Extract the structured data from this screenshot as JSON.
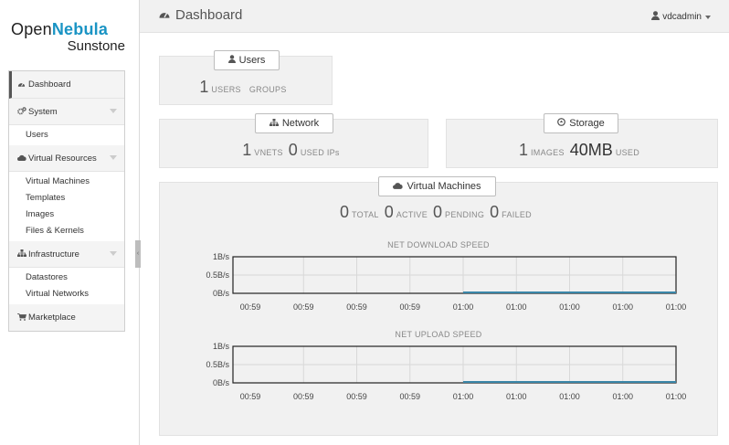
{
  "logo": {
    "open": "Open",
    "nebula": "Nebula",
    "sub": "Sunstone"
  },
  "sidebar": {
    "dashboard": "Dashboard",
    "system": "System",
    "system_items": [
      "Users"
    ],
    "virtual_resources": "Virtual Resources",
    "vr_items": [
      "Virtual Machines",
      "Templates",
      "Images",
      "Files & Kernels"
    ],
    "infrastructure": "Infrastructure",
    "infra_items": [
      "Datastores",
      "Virtual Networks"
    ],
    "marketplace": "Marketplace"
  },
  "header": {
    "title": "Dashboard",
    "user": "vdcadmin"
  },
  "users_panel": {
    "button": "Users",
    "users_count": "1",
    "users_label": "USERS",
    "groups_label": "GROUPS"
  },
  "network_panel": {
    "button": "Network",
    "vnets_count": "1",
    "vnets_label": "VNETS",
    "used_ips_count": "0",
    "used_ips_label": "USED IPs"
  },
  "storage_panel": {
    "button": "Storage",
    "images_count": "1",
    "images_label": "IMAGES",
    "used_size": "40MB",
    "used_label": "USED"
  },
  "vm_panel": {
    "button": "Virtual Machines",
    "total_count": "0",
    "total_label": "TOTAL",
    "active_count": "0",
    "active_label": "ACTIVE",
    "pending_count": "0",
    "pending_label": "PENDING",
    "failed_count": "0",
    "failed_label": "FAILED"
  },
  "chart_data": [
    {
      "type": "line",
      "title": "NET DOWNLOAD SPEED",
      "x": [
        "00:59",
        "00:59",
        "00:59",
        "00:59",
        "01:00",
        "01:00",
        "01:00",
        "01:00",
        "01:00"
      ],
      "y_ticks": [
        "1B/s",
        "0.5B/s",
        "0B/s"
      ],
      "ylim": [
        0,
        1
      ],
      "series": [
        {
          "values": [
            null,
            null,
            null,
            null,
            0,
            0,
            0,
            0,
            0
          ]
        }
      ],
      "grid": true,
      "line_color": "#3a86a8"
    },
    {
      "type": "line",
      "title": "NET UPLOAD SPEED",
      "x": [
        "00:59",
        "00:59",
        "00:59",
        "00:59",
        "01:00",
        "01:00",
        "01:00",
        "01:00",
        "01:00"
      ],
      "y_ticks": [
        "1B/s",
        "0.5B/s",
        "0B/s"
      ],
      "ylim": [
        0,
        1
      ],
      "series": [
        {
          "values": [
            null,
            null,
            null,
            null,
            0,
            0,
            0,
            0,
            0
          ]
        }
      ],
      "grid": true,
      "line_color": "#3a86a8"
    }
  ]
}
